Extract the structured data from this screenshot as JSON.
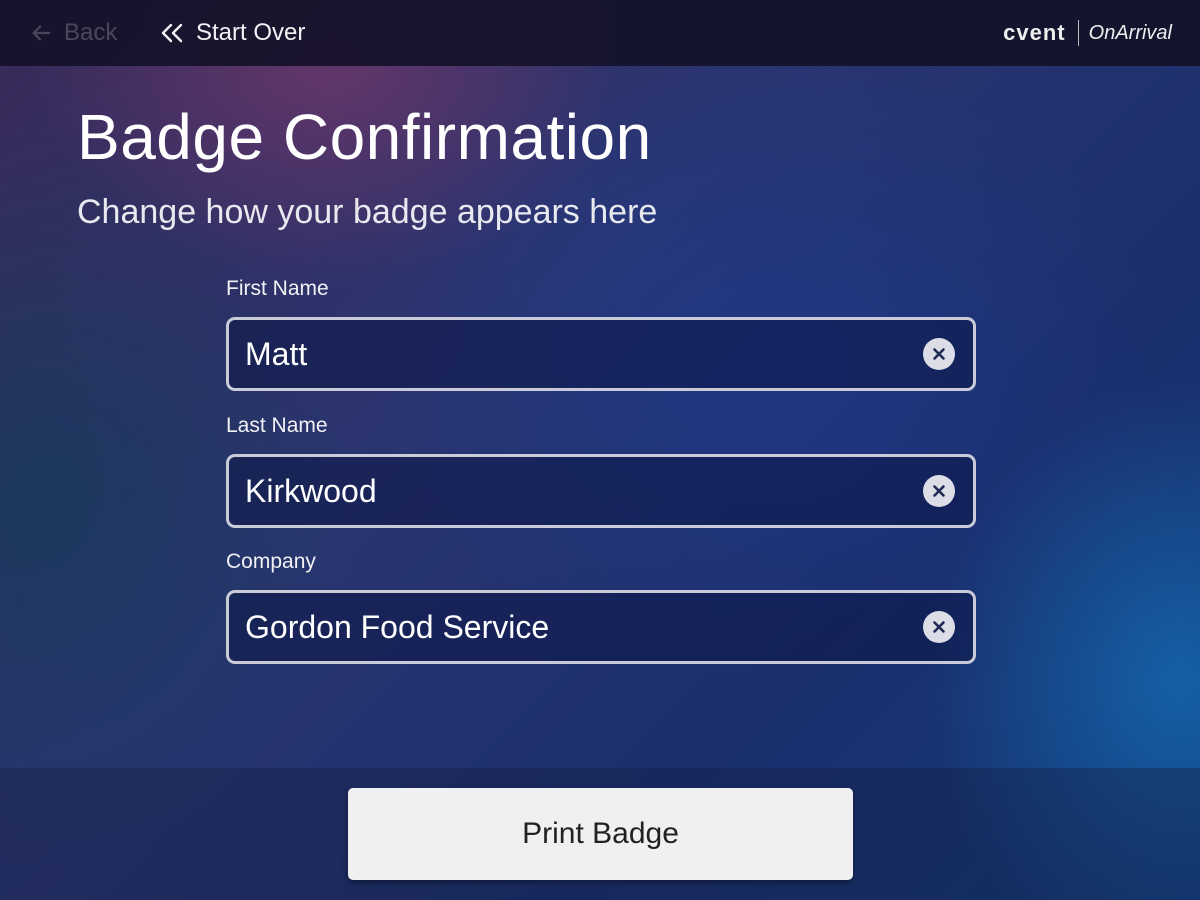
{
  "topbar": {
    "back_label": "Back",
    "start_over_label": "Start Over",
    "brand_name": "cvent",
    "brand_product": "OnArrival"
  },
  "page": {
    "title": "Badge Confirmation",
    "subtitle": "Change how your badge appears here"
  },
  "form": {
    "first_name": {
      "label": "First Name",
      "value": "Matt"
    },
    "last_name": {
      "label": "Last Name",
      "value": "Kirkwood"
    },
    "company": {
      "label": "Company",
      "value": "Gordon Food Service"
    }
  },
  "footer": {
    "print_label": "Print Badge"
  },
  "icons": {
    "back": "arrow-left-icon",
    "start_over": "double-chevron-left-icon",
    "clear": "clear-circle-x-icon"
  },
  "colors": {
    "topbar_bg": "#14122a",
    "field_border": "#c9ccd8",
    "button_bg": "#f0f0f2",
    "disabled_text": "#4a4a66"
  }
}
